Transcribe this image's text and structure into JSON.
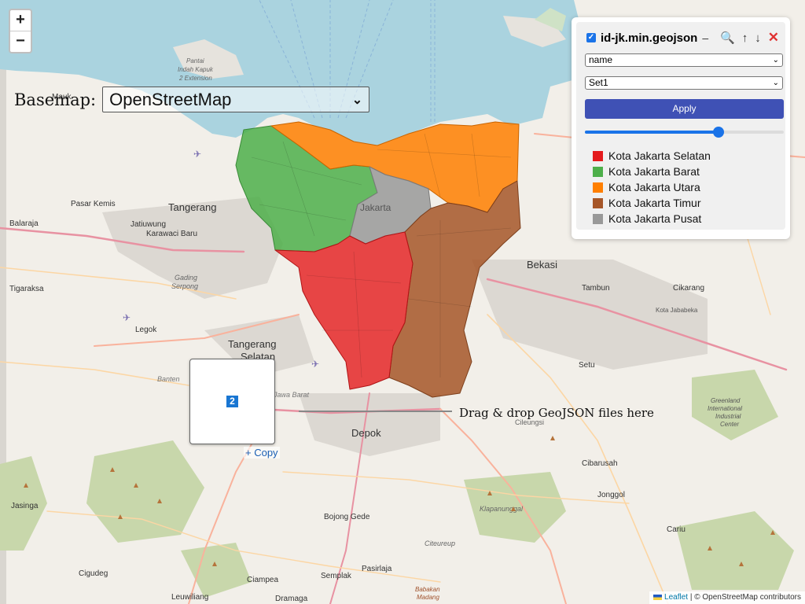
{
  "zoom": {
    "in_label": "+",
    "out_label": "−"
  },
  "basemap": {
    "label": "Basemap:",
    "selected": "OpenStreetMap"
  },
  "layer_panel": {
    "title": "id-jk.min.geojson",
    "dash": "–",
    "field_select": "name",
    "style_select": "Set1",
    "apply_label": "Apply",
    "opacity": 0.67,
    "legend": [
      {
        "label": "Kota Jakarta Selatan",
        "color": "#e41a1c"
      },
      {
        "label": "Kota Jakarta Barat",
        "color": "#4daf4a"
      },
      {
        "label": "Kota Jakarta Utara",
        "color": "#ff7f00"
      },
      {
        "label": "Kota Jakarta Timur",
        "color": "#a65628"
      },
      {
        "label": "Kota Jakarta Pusat",
        "color": "#999999"
      }
    ]
  },
  "drop_zone": {
    "badge": "2",
    "copy_label": "+ Copy",
    "hint": "Drag & drop GeoJSON files here"
  },
  "map_labels": [
    "Tangerang",
    "Jakarta",
    "Bekasi",
    "Depok",
    "Tangerang Selatan",
    "Pasar Kemis",
    "Jatiuwung",
    "Karawaci Baru",
    "Balaraja",
    "Tigaraksa",
    "Legok",
    "Gading Serpong",
    "Tambun",
    "Cikarang",
    "Kota Jababeka",
    "Setu",
    "Cileungsi",
    "Cibarusah",
    "Jonggol",
    "Bojong Gede",
    "Citeureup",
    "Cariu",
    "Jasinga",
    "Cigudeg",
    "Ciampea",
    "Semplak",
    "Pasirlaja",
    "Leuwiliang",
    "Dramaga",
    "Babakan Madang",
    "Mauk",
    "Pantai Indah Kapuk 2 Extension",
    "Greenland International Industrial Center",
    "Klapanunggal",
    "Banten",
    "Jawa Barat"
  ],
  "attribution": {
    "leaflet": "Leaflet",
    "rest": " | © OpenStreetMap contributors"
  }
}
